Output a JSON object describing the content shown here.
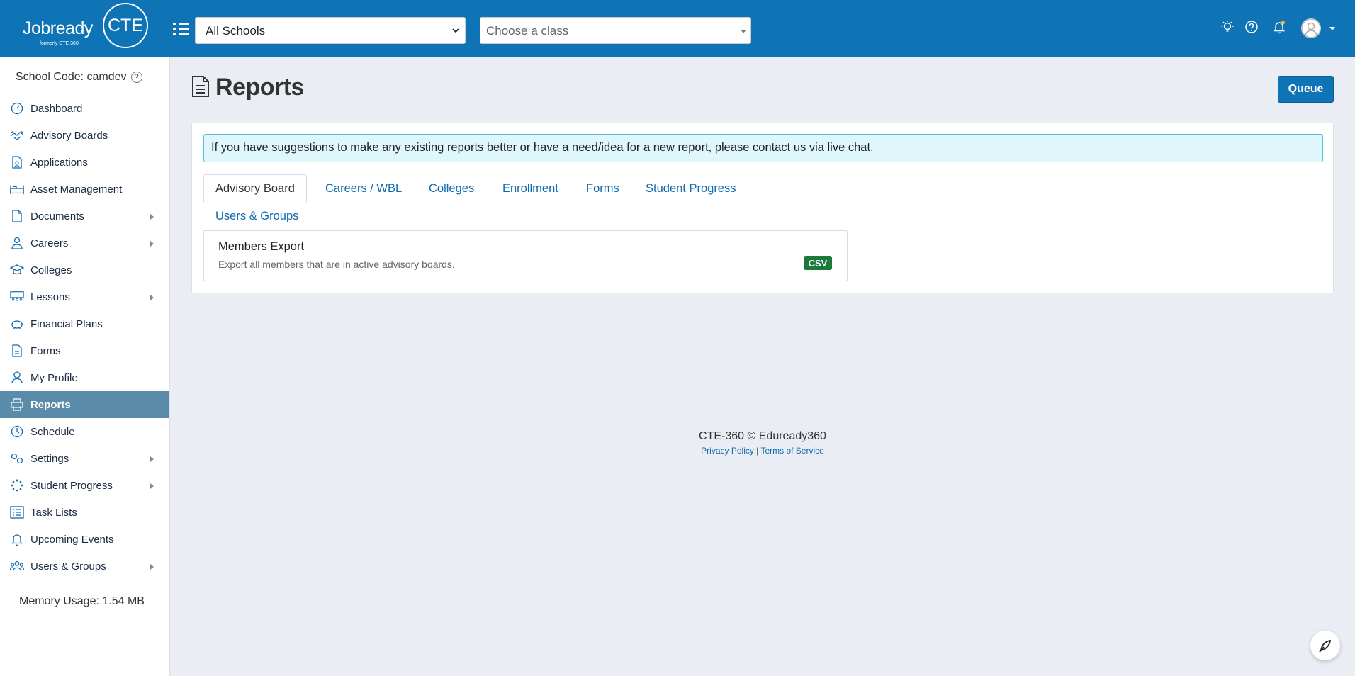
{
  "header": {
    "logo_main": "Jobready",
    "logo_badge": "CTE",
    "logo_sub": "formerly CTE 360",
    "school_select_value": "All Schools",
    "class_select_placeholder": "Choose a class"
  },
  "sidebar": {
    "school_code": "School Code: camdev",
    "help_glyph": "?",
    "items": [
      {
        "label": "Dashboard",
        "icon": "dashboard-icon",
        "has_children": false
      },
      {
        "label": "Advisory Boards",
        "icon": "handshake-icon",
        "has_children": false
      },
      {
        "label": "Applications",
        "icon": "application-icon",
        "has_children": false
      },
      {
        "label": "Asset Management",
        "icon": "asset-icon",
        "has_children": false
      },
      {
        "label": "Documents",
        "icon": "document-icon",
        "has_children": true
      },
      {
        "label": "Careers",
        "icon": "career-icon",
        "has_children": true
      },
      {
        "label": "Colleges",
        "icon": "graduation-cap-icon",
        "has_children": false
      },
      {
        "label": "Lessons",
        "icon": "lessons-icon",
        "has_children": true
      },
      {
        "label": "Financial Plans",
        "icon": "piggy-bank-icon",
        "has_children": false
      },
      {
        "label": "Forms",
        "icon": "form-icon",
        "has_children": false
      },
      {
        "label": "My Profile",
        "icon": "user-icon",
        "has_children": false
      },
      {
        "label": "Reports",
        "icon": "printer-icon",
        "has_children": false,
        "active": true
      },
      {
        "label": "Schedule",
        "icon": "clock-icon",
        "has_children": false
      },
      {
        "label": "Settings",
        "icon": "gears-icon",
        "has_children": true
      },
      {
        "label": "Student Progress",
        "icon": "spinner-icon",
        "has_children": true
      },
      {
        "label": "Task Lists",
        "icon": "list-icon",
        "has_children": false
      },
      {
        "label": "Upcoming Events",
        "icon": "bell-icon",
        "has_children": false
      },
      {
        "label": "Users & Groups",
        "icon": "users-icon",
        "has_children": true
      }
    ],
    "memory_usage": "Memory Usage: 1.54 MB"
  },
  "main": {
    "title": "Reports",
    "queue_label": "Queue",
    "alert_text": "If you have suggestions to make any existing reports better or have a need/idea for a new report, please contact us via live chat.",
    "tabs": [
      "Advisory Board",
      "Careers / WBL",
      "Colleges",
      "Enrollment",
      "Forms",
      "Student Progress",
      "Users & Groups"
    ],
    "active_tab": "Advisory Board",
    "report": {
      "title": "Members Export",
      "description": "Export all members that are in active advisory boards.",
      "format_badge": "CSV"
    }
  },
  "footer": {
    "copyright": "CTE-360 © Eduready360",
    "privacy_link": "Privacy Policy",
    "separator": "|",
    "terms_link": "Terms of Service"
  },
  "colors": {
    "header_bg": "#0e74b5",
    "active_nav_bg": "#5a8ca9",
    "link": "#0e6bb0",
    "csv_badge": "#1b7a3a"
  }
}
